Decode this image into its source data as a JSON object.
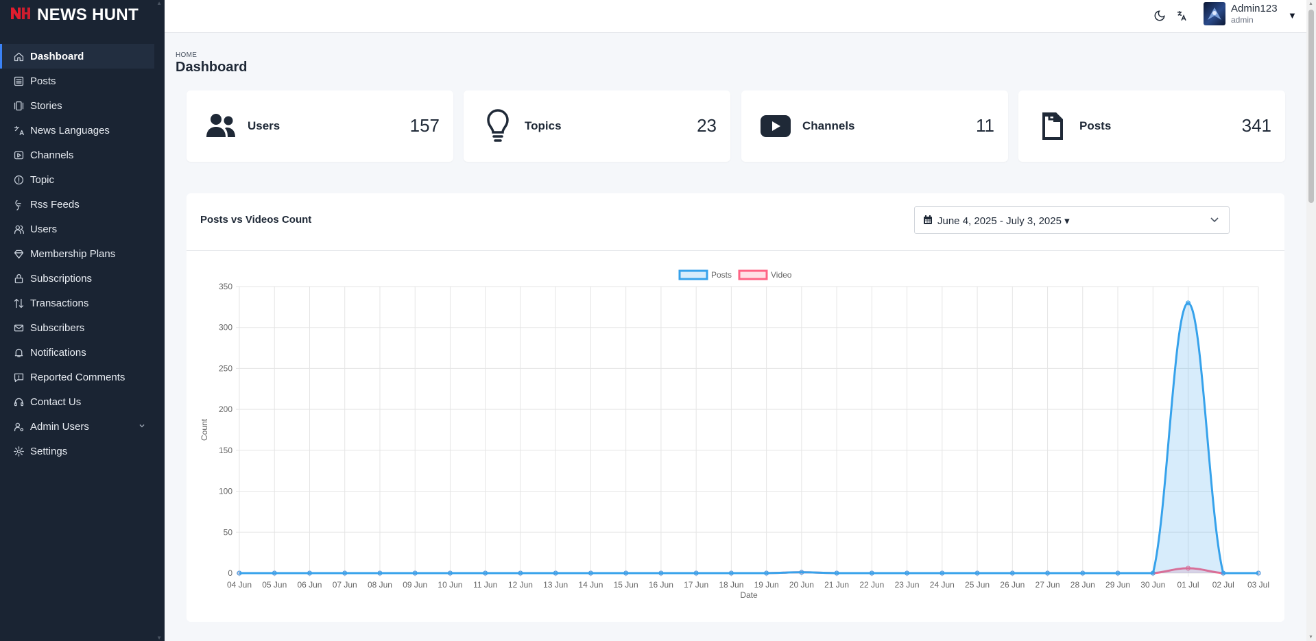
{
  "brand": {
    "mark": "N",
    "name": "NEWS HUNT"
  },
  "sidebar": {
    "items": [
      {
        "label": "Dashboard",
        "icon": "home-icon",
        "active": true
      },
      {
        "label": "Posts",
        "icon": "list-icon"
      },
      {
        "label": "Stories",
        "icon": "stories-icon"
      },
      {
        "label": "News Languages",
        "icon": "translate-icon"
      },
      {
        "label": "Channels",
        "icon": "play-icon"
      },
      {
        "label": "Topic",
        "icon": "info-circle-icon"
      },
      {
        "label": "Rss Feeds",
        "icon": "rss-icon"
      },
      {
        "label": "Users",
        "icon": "users-icon"
      },
      {
        "label": "Membership Plans",
        "icon": "diamond-icon"
      },
      {
        "label": "Subscriptions",
        "icon": "lock-icon"
      },
      {
        "label": "Transactions",
        "icon": "transfer-icon"
      },
      {
        "label": "Subscribers",
        "icon": "mail-icon"
      },
      {
        "label": "Notifications",
        "icon": "bell-icon"
      },
      {
        "label": "Reported Comments",
        "icon": "alert-comment-icon"
      },
      {
        "label": "Contact Us",
        "icon": "headset-icon"
      },
      {
        "label": "Admin Users",
        "icon": "user-cog-icon",
        "has_submenu": true
      },
      {
        "label": "Settings",
        "icon": "gear-icon"
      }
    ]
  },
  "header": {
    "user_name": "Admin123",
    "user_role": "admin"
  },
  "breadcrumb": "HOME",
  "page_title": "Dashboard",
  "stats": [
    {
      "label": "Users",
      "value": "157",
      "icon": "users-icon"
    },
    {
      "label": "Topics",
      "value": "23",
      "icon": "lightbulb-icon"
    },
    {
      "label": "Channels",
      "value": "11",
      "icon": "youtube-icon"
    },
    {
      "label": "Posts",
      "value": "341",
      "icon": "file-icon"
    }
  ],
  "chart_card": {
    "title": "Posts vs Videos Count",
    "date_range": "June 4, 2025 - July 3, 2025"
  },
  "chart_data": {
    "type": "line",
    "xlabel": "Date",
    "ylabel": "Count",
    "ylim": [
      0,
      350
    ],
    "yticks": [
      0,
      50,
      100,
      150,
      200,
      250,
      300,
      350
    ],
    "legend_position": "top",
    "grid": true,
    "categories": [
      "04 Jun",
      "05 Jun",
      "06 Jun",
      "07 Jun",
      "08 Jun",
      "09 Jun",
      "10 Jun",
      "11 Jun",
      "12 Jun",
      "13 Jun",
      "14 Jun",
      "15 Jun",
      "16 Jun",
      "17 Jun",
      "18 Jun",
      "19 Jun",
      "20 Jun",
      "21 Jun",
      "22 Jun",
      "23 Jun",
      "24 Jun",
      "25 Jun",
      "26 Jun",
      "27 Jun",
      "28 Jun",
      "29 Jun",
      "30 Jun",
      "01 Jul",
      "02 Jul",
      "03 Jul"
    ],
    "series": [
      {
        "name": "Posts",
        "color": "#36a2eb",
        "fill": "rgba(54,162,235,0.2)",
        "values": [
          0,
          0,
          0,
          0,
          0,
          0,
          0,
          0,
          0,
          0,
          0,
          0,
          0,
          0,
          0,
          0,
          1,
          0,
          0,
          0,
          0,
          0,
          0,
          0,
          0,
          0,
          0,
          330,
          0,
          0
        ]
      },
      {
        "name": "Video",
        "color": "#ff6384",
        "fill": "rgba(255,99,132,0.2)",
        "values": [
          0,
          0,
          0,
          0,
          0,
          0,
          0,
          0,
          0,
          0,
          0,
          0,
          0,
          0,
          0,
          0,
          1,
          0,
          0,
          0,
          0,
          0,
          0,
          0,
          0,
          0,
          0,
          6,
          0,
          0
        ]
      }
    ]
  }
}
